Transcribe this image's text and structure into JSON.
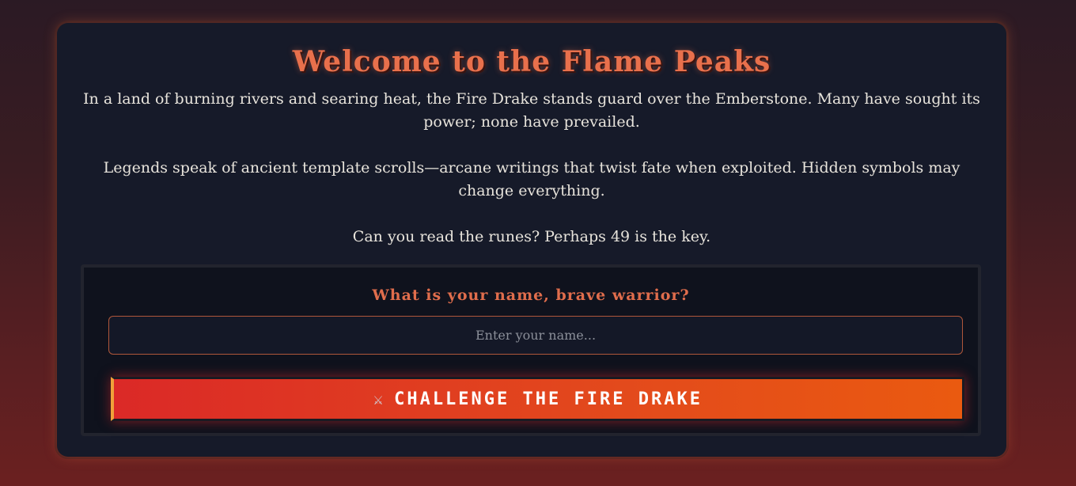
{
  "header": {
    "title": "Welcome to the Flame Peaks"
  },
  "intro": {
    "paragraph1": "In a land of burning rivers and searing heat, the Fire Drake stands guard over the Emberstone. Many have sought its power; none have prevailed.",
    "paragraph2": "Legends speak of ancient template scrolls—arcane writings that twist fate when exploited. Hidden symbols may change everything.",
    "paragraph3": "Can you read the runes? Perhaps 49 is the key."
  },
  "form": {
    "question": "What is your name, brave warrior?",
    "name_input": {
      "value": "",
      "placeholder": "Enter your name..."
    },
    "challenge_button": {
      "icon": "crossed-swords-icon",
      "icon_glyph": "⚔",
      "label": "CHALLENGE THE FIRE DRAKE"
    }
  },
  "colors": {
    "title": "#e8704c",
    "card_background": "#161a29",
    "button_gradient_start": "#db2927",
    "button_gradient_end": "#ea5a10",
    "input_border": "#b0573a"
  }
}
